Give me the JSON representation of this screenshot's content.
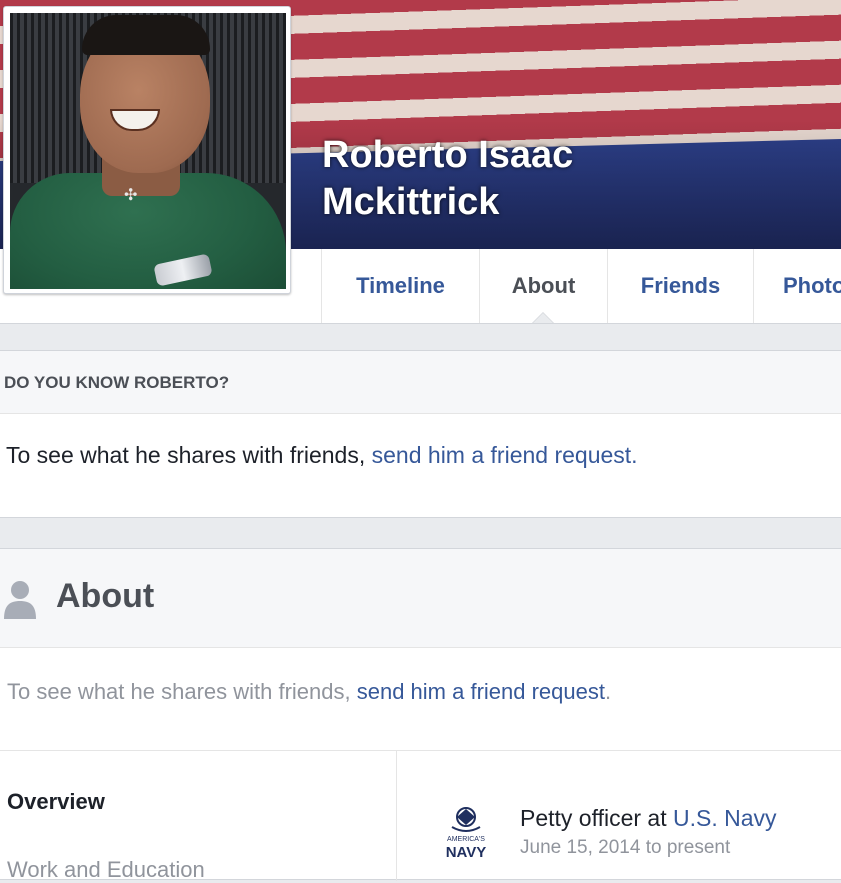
{
  "profile": {
    "name": "Roberto Isaac Mckittrick"
  },
  "tabs": [
    {
      "label": "Timeline",
      "active": false
    },
    {
      "label": "About",
      "active": true
    },
    {
      "label": "Friends",
      "active": false
    },
    {
      "label": "Photo",
      "active": false
    }
  ],
  "know_card": {
    "heading": "DO YOU KNOW ROBERTO?",
    "text": "To see what he shares with friends, ",
    "link": "send him a friend request."
  },
  "about": {
    "title": "About",
    "note_text": "To see what he shares with friends, ",
    "note_link": "send him a friend request",
    "note_end": ".",
    "overview_label": "Overview",
    "next_section": "Work and Education",
    "work": {
      "role_prefix": "Petty officer at ",
      "employer": "U.S. Navy",
      "dates_start": "June 15, 2014",
      "dates_sep": " to ",
      "dates_end": "present",
      "logo_text": "NAVY",
      "logo_arc": "AMERICA'S"
    }
  },
  "colors": {
    "link": "#365899",
    "muted": "#90949c",
    "page_bg": "#e9ebee"
  }
}
